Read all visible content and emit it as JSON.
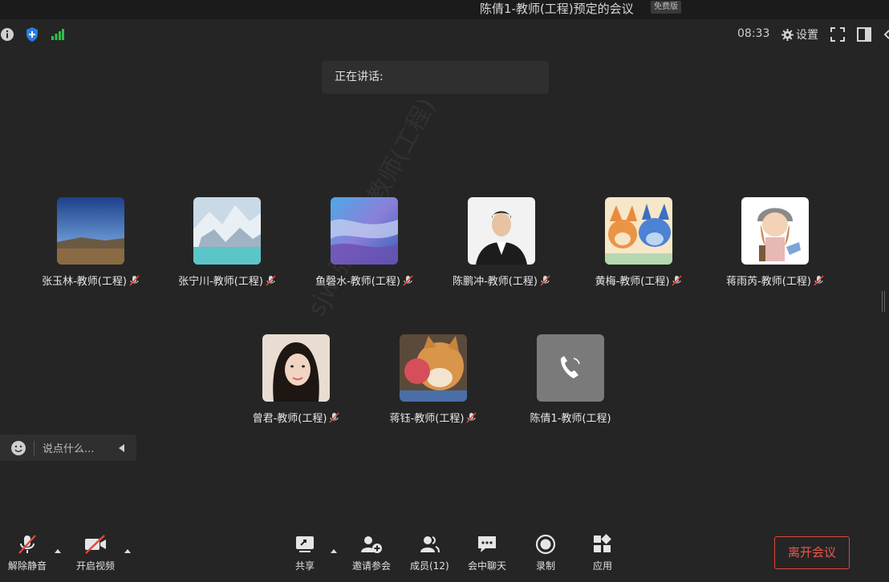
{
  "window": {
    "title": "陈倩1-教师(工程)预定的会议",
    "edition_badge": "免费版"
  },
  "topbar": {
    "time": "08:33",
    "settings_label": "设置"
  },
  "speaking": {
    "label": "正在讲话:"
  },
  "participants_row1": [
    {
      "name": "张玉林-教师(工程)",
      "avatar": "avatar-landscape",
      "muted": true
    },
    {
      "name": "张宁川-教师(工程)",
      "avatar": "avatar-waterfall",
      "muted": true
    },
    {
      "name": "鱼磬水-教师(工程)",
      "avatar": "avatar-painting",
      "muted": true
    },
    {
      "name": "陈鹏冲-教师(工程)",
      "avatar": "avatar-man-suit",
      "muted": true
    },
    {
      "name": "黄梅-教师(工程)",
      "avatar": "avatar-cartoon-dogs",
      "muted": true
    },
    {
      "name": "蒋雨芮-教师(工程)",
      "avatar": "avatar-cartoon-girl",
      "muted": true
    }
  ],
  "participants_row2": [
    {
      "name": "曾君-教师(工程)",
      "avatar": "avatar-woman",
      "muted": true
    },
    {
      "name": "蒋钰-教师(工程)",
      "avatar": "avatar-shiba",
      "muted": true
    },
    {
      "name": "陈倩1-教师(工程)",
      "avatar": "avatar-phone",
      "muted": false
    }
  ],
  "chat": {
    "placeholder": "说点什么..."
  },
  "toolbar": {
    "unmute_label": "解除静音",
    "start_video_label": "开启视频",
    "share_label": "共享",
    "invite_label": "邀请参会",
    "members_label": "成员(12)",
    "chat_label": "会中聊天",
    "record_label": "录制",
    "apps_label": "应用",
    "leave_label": "离开会议"
  },
  "watermark": {
    "text": "sjw 张玉林-教师(工程)"
  },
  "colors": {
    "background": "#252525",
    "leave_red": "#e0463c",
    "signal_green": "#2fbf4a",
    "shield_blue": "#2a7de1",
    "muted_red": "#e2463c"
  }
}
